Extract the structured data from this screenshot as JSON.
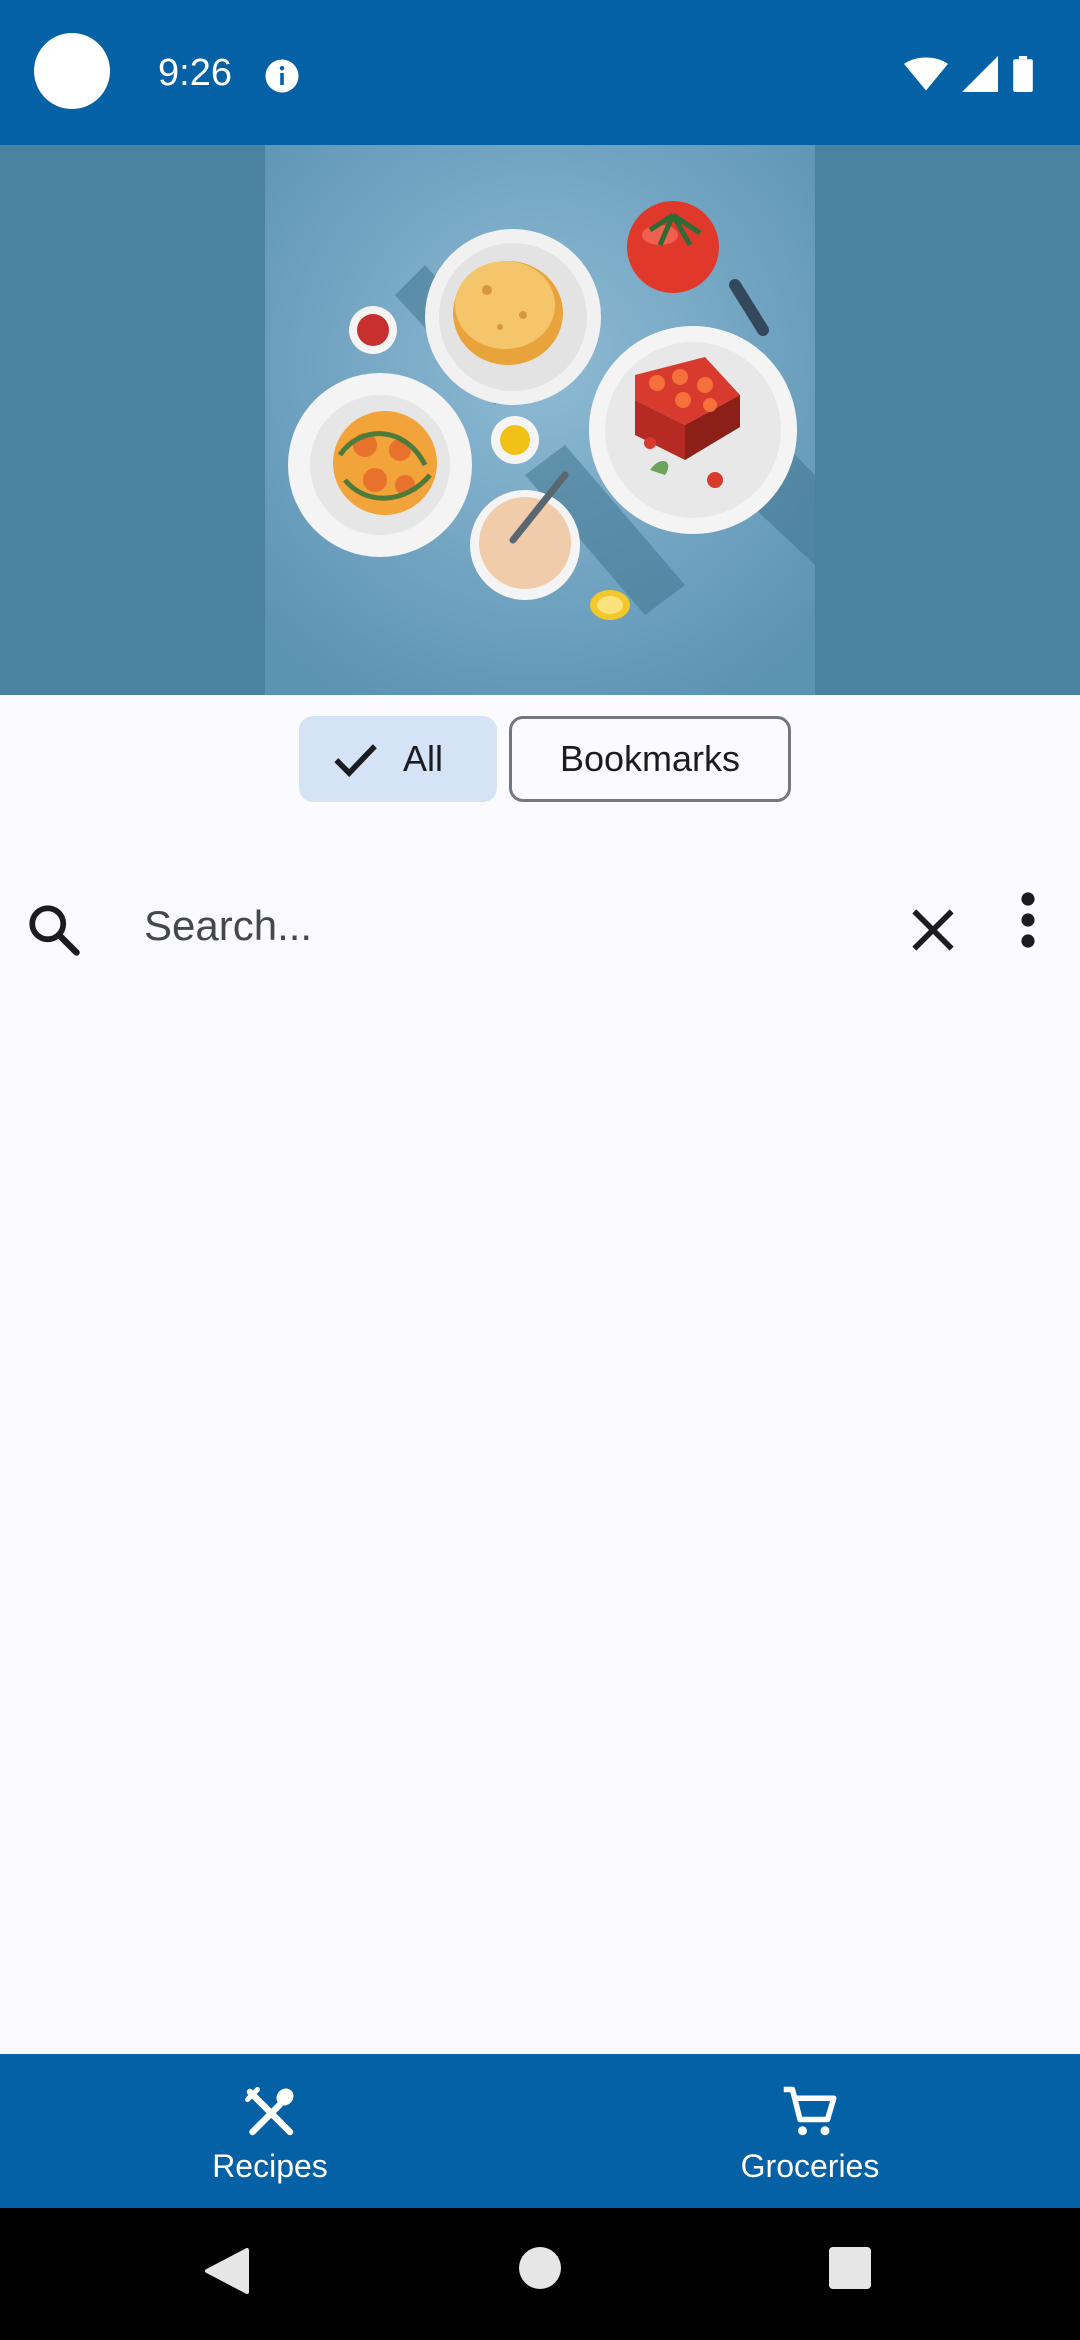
{
  "status_bar": {
    "time": "9:26",
    "icons": [
      "camera-cutout",
      "info-icon",
      "wifi-icon",
      "signal-icon",
      "battery-icon"
    ]
  },
  "hero": {
    "image": "food-plates-illustration"
  },
  "filters": {
    "chips": [
      {
        "label": "All",
        "selected": true,
        "icon": "check-icon"
      },
      {
        "label": "Bookmarks",
        "selected": false
      }
    ]
  },
  "search": {
    "placeholder": "Search...",
    "value": "",
    "icons": [
      "search-icon",
      "close-icon",
      "more-vert-icon"
    ]
  },
  "bottom_nav": {
    "items": [
      {
        "label": "Recipes",
        "icon": "restaurant-icon",
        "selected": true
      },
      {
        "label": "Groceries",
        "icon": "cart-icon",
        "selected": false
      }
    ]
  },
  "system_nav": {
    "buttons": [
      "back-button",
      "home-button",
      "recents-button"
    ]
  },
  "colors": {
    "primary": "#0561a6",
    "hero_bg": "#4a83a1",
    "chip_selected": "#d4e3f6",
    "surface": "#fbfaff"
  }
}
